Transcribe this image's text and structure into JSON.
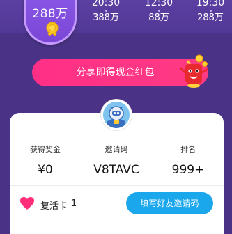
{
  "prize": {
    "amount": "288万"
  },
  "schedule": [
    {
      "time": "20:30",
      "amount": "388万"
    },
    {
      "time": "12:30",
      "amount": "88万"
    },
    {
      "time": "19:30",
      "amount": "288万"
    }
  ],
  "share_button": {
    "label": "分享即得现金红包"
  },
  "stats": [
    {
      "label": "获得奖金",
      "value": "¥0"
    },
    {
      "label": "邀请码",
      "value": "V8TAVC"
    },
    {
      "label": "排名",
      "value": "999+"
    }
  ],
  "revive_card": {
    "label": "复活卡",
    "count": "1"
  },
  "invite_button": {
    "label": "填写好友邀请码"
  },
  "colors": {
    "background": "#4a3387",
    "accent_pink": "#ff2f86",
    "accent_blue": "#1aa7ec",
    "heart": "#ff2d7a"
  },
  "icons": [
    "gold-medal-icon",
    "red-envelope-mascot-icon",
    "robot-avatar-icon",
    "heart-icon"
  ]
}
